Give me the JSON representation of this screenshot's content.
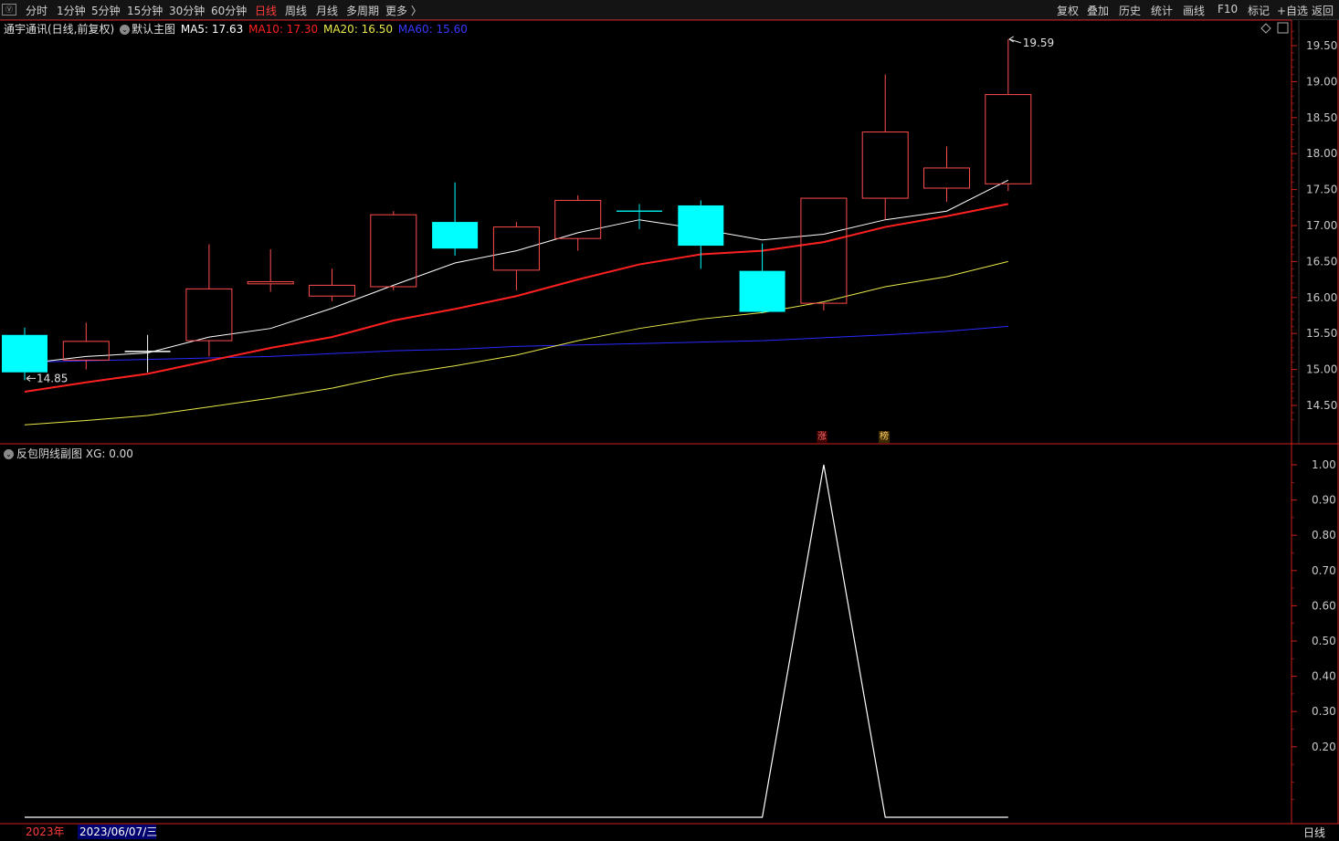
{
  "toolbar": {
    "logo": "Ⓥ",
    "periods": [
      "分时",
      "1分钟",
      "5分钟",
      "15分钟",
      "30分钟",
      "60分钟",
      "日线",
      "周线",
      "月线",
      "多周期",
      "更多 〉"
    ],
    "active_period": "日线",
    "actions": [
      "复权",
      "叠加",
      "历史",
      "统计",
      "画线",
      "F10",
      "标记",
      "+自选",
      "返回"
    ]
  },
  "stock": {
    "name": "通宇通讯(日线,前复权)",
    "template": "默认主图",
    "ma5": "MA5: 17.63",
    "ma10": "MA10: 17.30",
    "ma20": "MA20: 16.50",
    "ma60": "MA60: 15.60"
  },
  "colors": {
    "up": "#ff4d4d",
    "down": "#00ffff",
    "ma5": "#ffffff",
    "ma10": "#ff2020",
    "ma20": "#e8e84a",
    "ma60": "#2a2aff",
    "axis": "#cc2020",
    "bg": "#000000"
  },
  "indicator": {
    "name": "反包阴线副图",
    "value": "XG: 0.00"
  },
  "markers": {
    "zhang": "涨",
    "bang": "榜"
  },
  "bottom": {
    "year": "2023年",
    "date": "2023/06/07/三",
    "period": "日线"
  },
  "chart_data": [
    {
      "type": "candlestick",
      "title": "通宇通讯(日线,前复权)",
      "y_ticks": [
        "19.50",
        "19.00",
        "18.50",
        "18.00",
        "17.50",
        "17.00",
        "16.50",
        "16.00",
        "15.50",
        "15.00",
        "14.50"
      ],
      "ylim": [
        14.25,
        19.75
      ],
      "candles": [
        {
          "o": 15.48,
          "c": 14.96,
          "h": 15.58,
          "l": 14.85
        },
        {
          "o": 15.13,
          "c": 15.39,
          "h": 15.65,
          "l": 15.0
        },
        {
          "o": 15.25,
          "c": 15.25,
          "h": 15.48,
          "l": 14.96
        },
        {
          "o": 15.4,
          "c": 16.12,
          "h": 16.74,
          "l": 15.18
        },
        {
          "o": 16.19,
          "c": 16.22,
          "h": 16.67,
          "l": 16.08
        },
        {
          "o": 16.02,
          "c": 16.17,
          "h": 16.4,
          "l": 15.95
        },
        {
          "o": 16.15,
          "c": 17.15,
          "h": 17.2,
          "l": 16.1
        },
        {
          "o": 17.05,
          "c": 16.68,
          "h": 17.6,
          "l": 16.58
        },
        {
          "o": 16.38,
          "c": 16.98,
          "h": 17.05,
          "l": 16.1
        },
        {
          "o": 16.82,
          "c": 17.35,
          "h": 17.42,
          "l": 16.65
        },
        {
          "o": 17.2,
          "c": 17.2,
          "h": 17.3,
          "l": 16.95
        },
        {
          "o": 17.28,
          "c": 16.72,
          "h": 17.35,
          "l": 16.4
        },
        {
          "o": 16.37,
          "c": 15.8,
          "h": 16.75,
          "l": 15.78
        },
        {
          "o": 15.92,
          "c": 17.38,
          "h": 17.38,
          "l": 15.82
        },
        {
          "o": 17.38,
          "c": 18.3,
          "h": 19.1,
          "l": 17.08
        },
        {
          "o": 17.52,
          "c": 17.8,
          "h": 18.1,
          "l": 17.33
        },
        {
          "o": 17.58,
          "c": 18.82,
          "h": 19.59,
          "l": 17.48
        }
      ],
      "ma5": [
        15.08,
        15.18,
        15.23,
        15.45,
        15.57,
        15.85,
        16.17,
        16.48,
        16.65,
        16.9,
        17.08,
        16.95,
        16.8,
        16.88,
        17.08,
        17.2,
        17.63
      ],
      "ma10": [
        14.69,
        14.82,
        14.94,
        15.12,
        15.3,
        15.45,
        15.68,
        15.84,
        16.02,
        16.25,
        16.46,
        16.6,
        16.65,
        16.77,
        16.98,
        17.13,
        17.3
      ],
      "ma20": [
        14.23,
        14.29,
        14.36,
        14.48,
        14.6,
        14.74,
        14.92,
        15.05,
        15.2,
        15.4,
        15.57,
        15.7,
        15.79,
        15.94,
        16.15,
        16.29,
        16.5
      ],
      "ma60": [
        15.1,
        15.12,
        15.14,
        15.16,
        15.18,
        15.22,
        15.26,
        15.28,
        15.32,
        15.34,
        15.36,
        15.38,
        15.4,
        15.44,
        15.48,
        15.53,
        15.6
      ],
      "labels": {
        "high": "19.59",
        "low": "14.85"
      }
    },
    {
      "type": "line",
      "title": "反包阴线副图",
      "y_ticks": [
        "1.00",
        "0.90",
        "0.80",
        "0.70",
        "0.60",
        "0.50",
        "0.40",
        "0.30",
        "0.20"
      ],
      "ylim": [
        0,
        1.0
      ],
      "series": [
        {
          "name": "XG",
          "values": [
            0,
            0,
            0,
            0,
            0,
            0,
            0,
            0,
            0,
            0,
            0,
            0,
            0,
            1,
            0,
            0,
            0
          ]
        }
      ]
    }
  ]
}
